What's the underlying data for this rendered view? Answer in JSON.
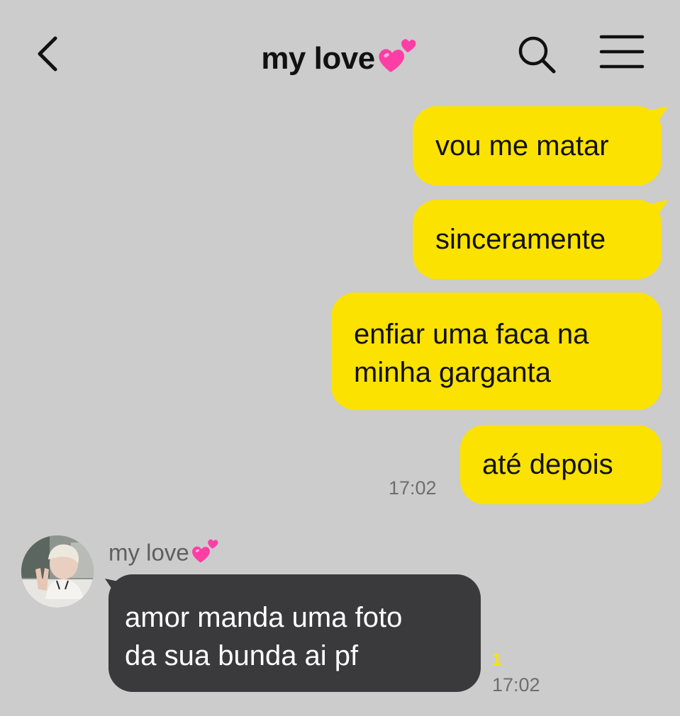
{
  "header": {
    "title": "my love",
    "title_emoji": "two-hearts-icon"
  },
  "messages": [
    {
      "direction": "outgoing",
      "text": "vou me matar"
    },
    {
      "direction": "outgoing",
      "text": "sinceramente"
    },
    {
      "direction": "outgoing",
      "text_line1": "enfiar uma faca na",
      "text_line2": "minha garganta"
    },
    {
      "direction": "outgoing",
      "text": "até depois",
      "time": "17:02"
    },
    {
      "direction": "incoming",
      "sender": "my love",
      "text_line1": "amor manda uma foto",
      "text_line2": "da sua bunda ai pf",
      "unread_count": "1",
      "time": "17:02"
    }
  ],
  "colors": {
    "background": "#cccccc",
    "outgoing_bubble": "#fce200",
    "incoming_bubble": "#3a3a3c",
    "unread_indicator": "#fce200",
    "heart_pink": "#ff3ea5"
  }
}
